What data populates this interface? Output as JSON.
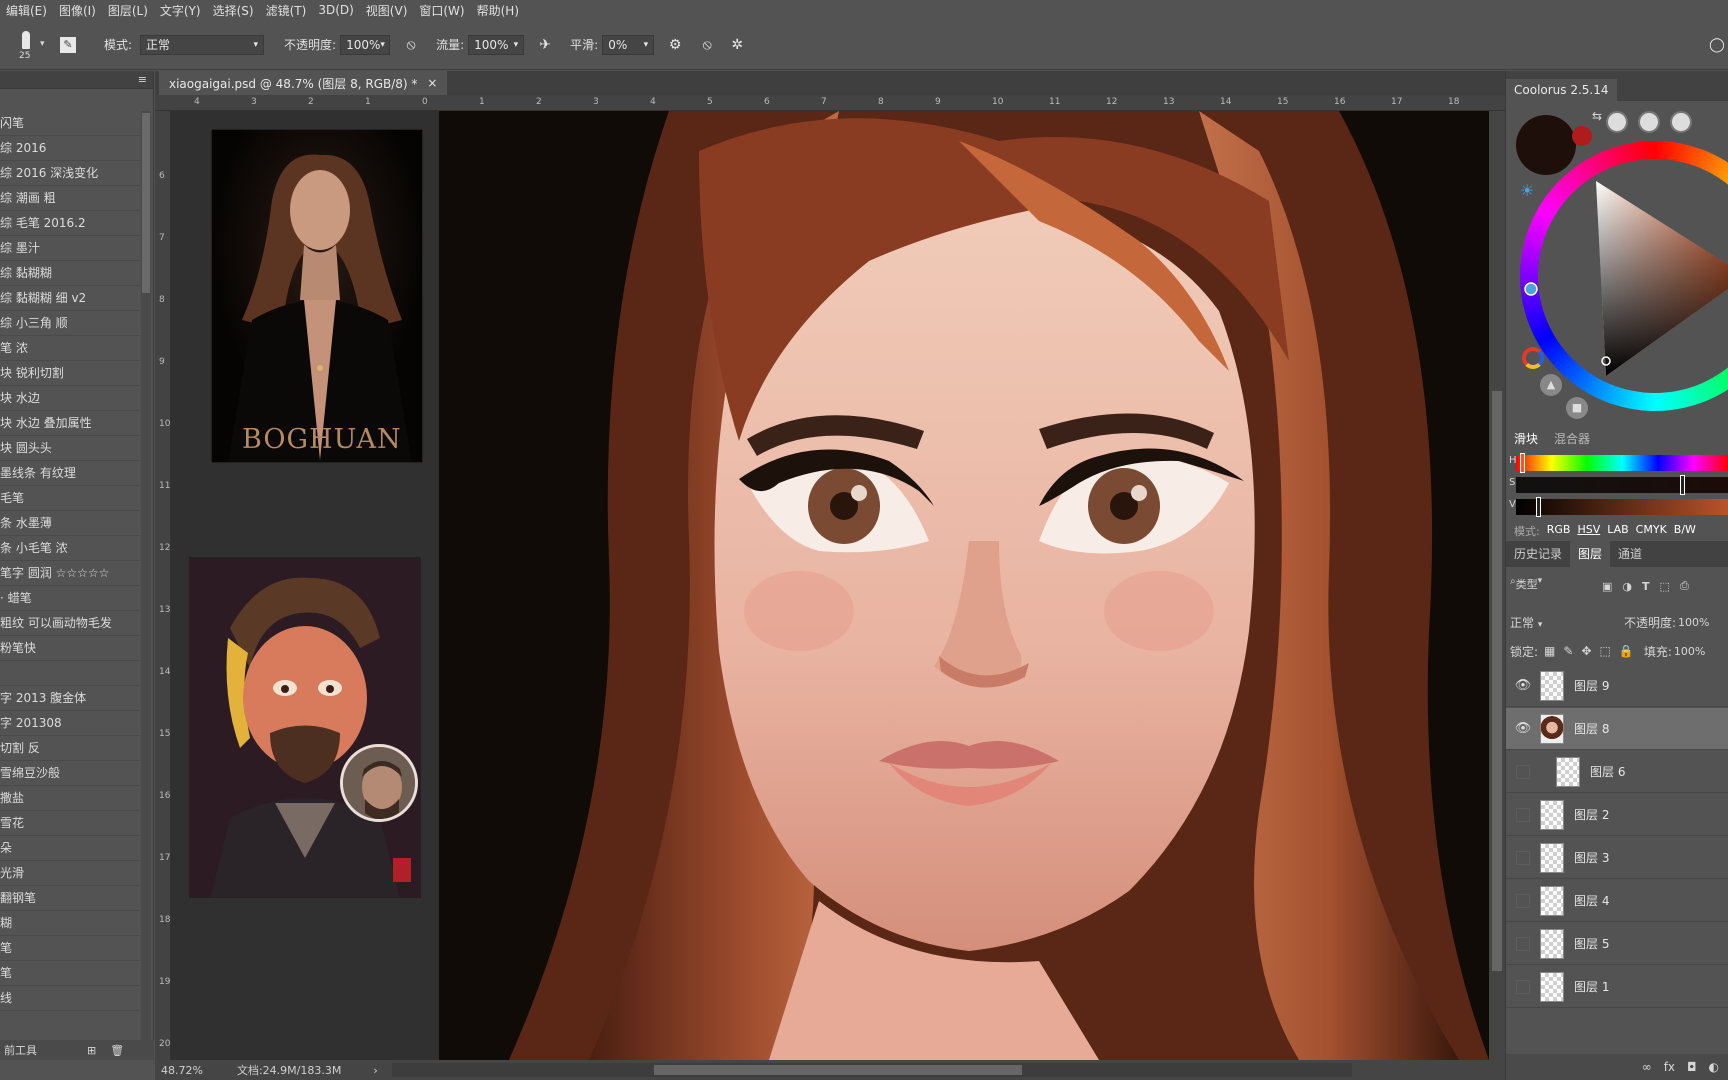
{
  "menu": [
    "编辑(E)",
    "图像(I)",
    "图层(L)",
    "文字(Y)",
    "选择(S)",
    "滤镜(T)",
    "3D(D)",
    "视图(V)",
    "窗口(W)",
    "帮助(H)"
  ],
  "options": {
    "brush_size": "25",
    "mode_label": "模式:",
    "mode_value": "正常",
    "opacity_label": "不透明度:",
    "opacity_value": "100%",
    "flow_label": "流量:",
    "flow_value": "100%",
    "smooth_label": "平滑:",
    "smooth_value": "0%"
  },
  "document": {
    "tab_title": "xiaogaigai.psd @ 48.7% (图层 8, RGB/8) *",
    "close": "×",
    "zoom": "48.72%",
    "doc_size": "文档:24.9M/183.3M"
  },
  "brushes": [
    "闪笔",
    "综 2016",
    "综 2016 深浅变化",
    "综 潮画 粗",
    "综 毛笔 2016.2",
    "综 墨汁",
    "综 黏糊糊",
    "综 黏糊糊 细 v2",
    "综 小三角 顺",
    "笔 浓",
    "块 锐利切割",
    "块 水边",
    "块 水边 叠加属性",
    "块 圆头头",
    "墨线条 有纹理",
    "毛笔",
    "条 水墨薄",
    "条 小毛笔 浓",
    "笔字 圆润 ☆☆☆☆☆",
    "· 蜡笔",
    "粗纹 可以画动物毛发",
    "粉笔快",
    "",
    "字 2013 腹金体",
    "字 201308",
    "切割 反",
    "雪绵豆沙般",
    "撒盐",
    "雪花",
    "朵",
    "光滑",
    "翻钢笔",
    "糊",
    "笔",
    "笔",
    "线"
  ],
  "left_footer": "前工具",
  "ruler_h": [
    "4",
    "3",
    "2",
    "1",
    "0",
    "1",
    "2",
    "3",
    "4",
    "5",
    "6",
    "7",
    "8",
    "9",
    "10",
    "11",
    "12",
    "13",
    "14",
    "15",
    "16",
    "17",
    "18"
  ],
  "ruler_v": [
    "6",
    "7",
    "8",
    "9",
    "10",
    "11",
    "12",
    "13",
    "14",
    "15",
    "16",
    "17",
    "18",
    "19",
    "20"
  ],
  "reference": {
    "poster_text": "BOGHUAN"
  },
  "color_panel": {
    "title": "Coolorus 2.5.14",
    "tab_sliders": "滑块",
    "tab_mixer": "混合器",
    "mode_label": "模式:",
    "modes": [
      "RGB",
      "HSV",
      "LAB",
      "CMYK",
      "B/W"
    ],
    "active_mode": "HSV",
    "hsv_letters": [
      "H",
      "S",
      "V"
    ],
    "current_color": "#1f0f0b",
    "secondary_color": "#b01b1b"
  },
  "layers_panel": {
    "tabs": [
      "历史记录",
      "图层",
      "通道"
    ],
    "active_tab": "图层",
    "filter_label": "类型",
    "blend_mode": "正常",
    "opacity_label": "不透明度:",
    "opacity_value": "100%",
    "lock_label": "锁定:",
    "fill_label": "填充:",
    "fill_value": "100%",
    "layers": [
      {
        "name": "图层 9",
        "visible": true,
        "selected": false
      },
      {
        "name": "图层 8",
        "visible": true,
        "selected": true
      },
      {
        "name": "图层 6",
        "visible": false,
        "selected": false
      },
      {
        "name": "图层 2",
        "visible": false,
        "selected": false
      },
      {
        "name": "图层 3",
        "visible": false,
        "selected": false
      },
      {
        "name": "图层 4",
        "visible": false,
        "selected": false
      },
      {
        "name": "图层 5",
        "visible": false,
        "selected": false
      },
      {
        "name": "图层 1",
        "visible": false,
        "selected": false
      }
    ]
  }
}
